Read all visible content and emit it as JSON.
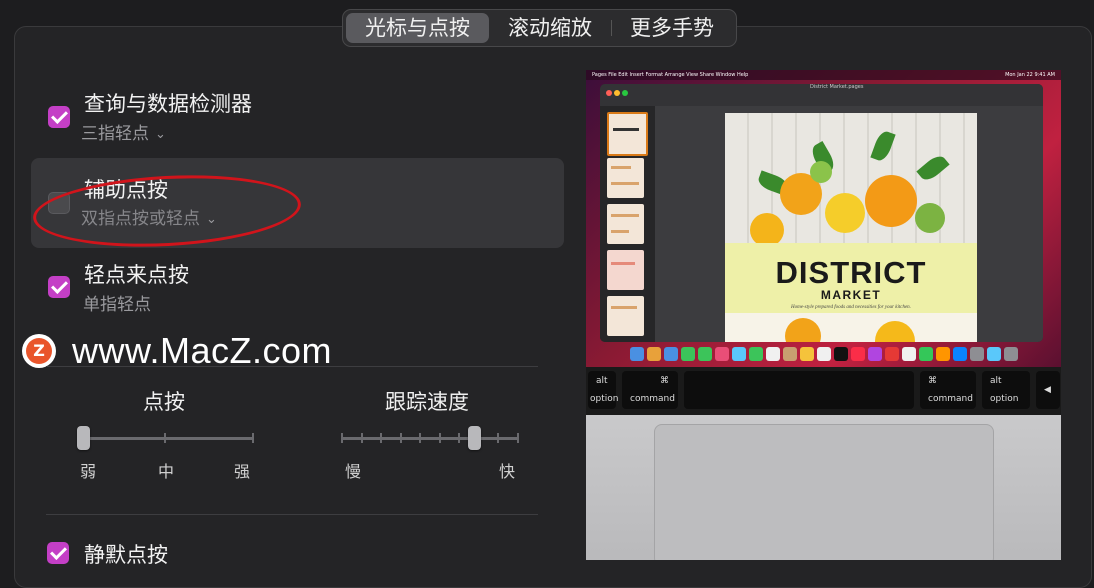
{
  "tabs": [
    {
      "label": "光标与点按",
      "active": true
    },
    {
      "label": "滚动缩放",
      "active": false
    },
    {
      "label": "更多手势",
      "active": false
    }
  ],
  "options": [
    {
      "title": "查询与数据检测器",
      "subtitle": "三指轻点",
      "checked": true,
      "has_dropdown": true
    },
    {
      "title": "辅助点按",
      "subtitle": "双指点按或轻点",
      "checked": false,
      "has_dropdown": true
    },
    {
      "title": "轻点来点按",
      "subtitle": "单指轻点",
      "checked": true,
      "has_dropdown": false
    }
  ],
  "watermark": {
    "text": "www.MacZ.com",
    "badge": "Z"
  },
  "sliders": {
    "click": {
      "label": "点按",
      "min_label": "弱",
      "mid_label": "中",
      "max_label": "强",
      "value_index": 0,
      "stops": 3
    },
    "tracking": {
      "label": "跟踪速度",
      "min_label": "慢",
      "max_label": "快",
      "value_fraction": 0.75,
      "stops": 10
    }
  },
  "bottom_option": {
    "title": "静默点按",
    "checked": true
  },
  "preview": {
    "menu_left": "Pages  File  Edit  Insert  Format  Arrange  View  Share  Window  Help",
    "menu_right": "Mon Jan 22  9:41 AM",
    "doc_title": "District Market.pages",
    "page_title": "DISTRICT",
    "page_subtitle": "MARKET",
    "page_tagline": "Home-style prepared foods and necessities for your kitchen.",
    "keys": {
      "alt_left": "alt",
      "option_left": "option",
      "cmd_symbol": "⌘",
      "command": "command",
      "alt_right": "alt",
      "option_right": "option",
      "arrow": "◀"
    }
  },
  "colors": {
    "accent": "#c43fc6",
    "annotation": "#d1141b",
    "panel": "#242426"
  }
}
